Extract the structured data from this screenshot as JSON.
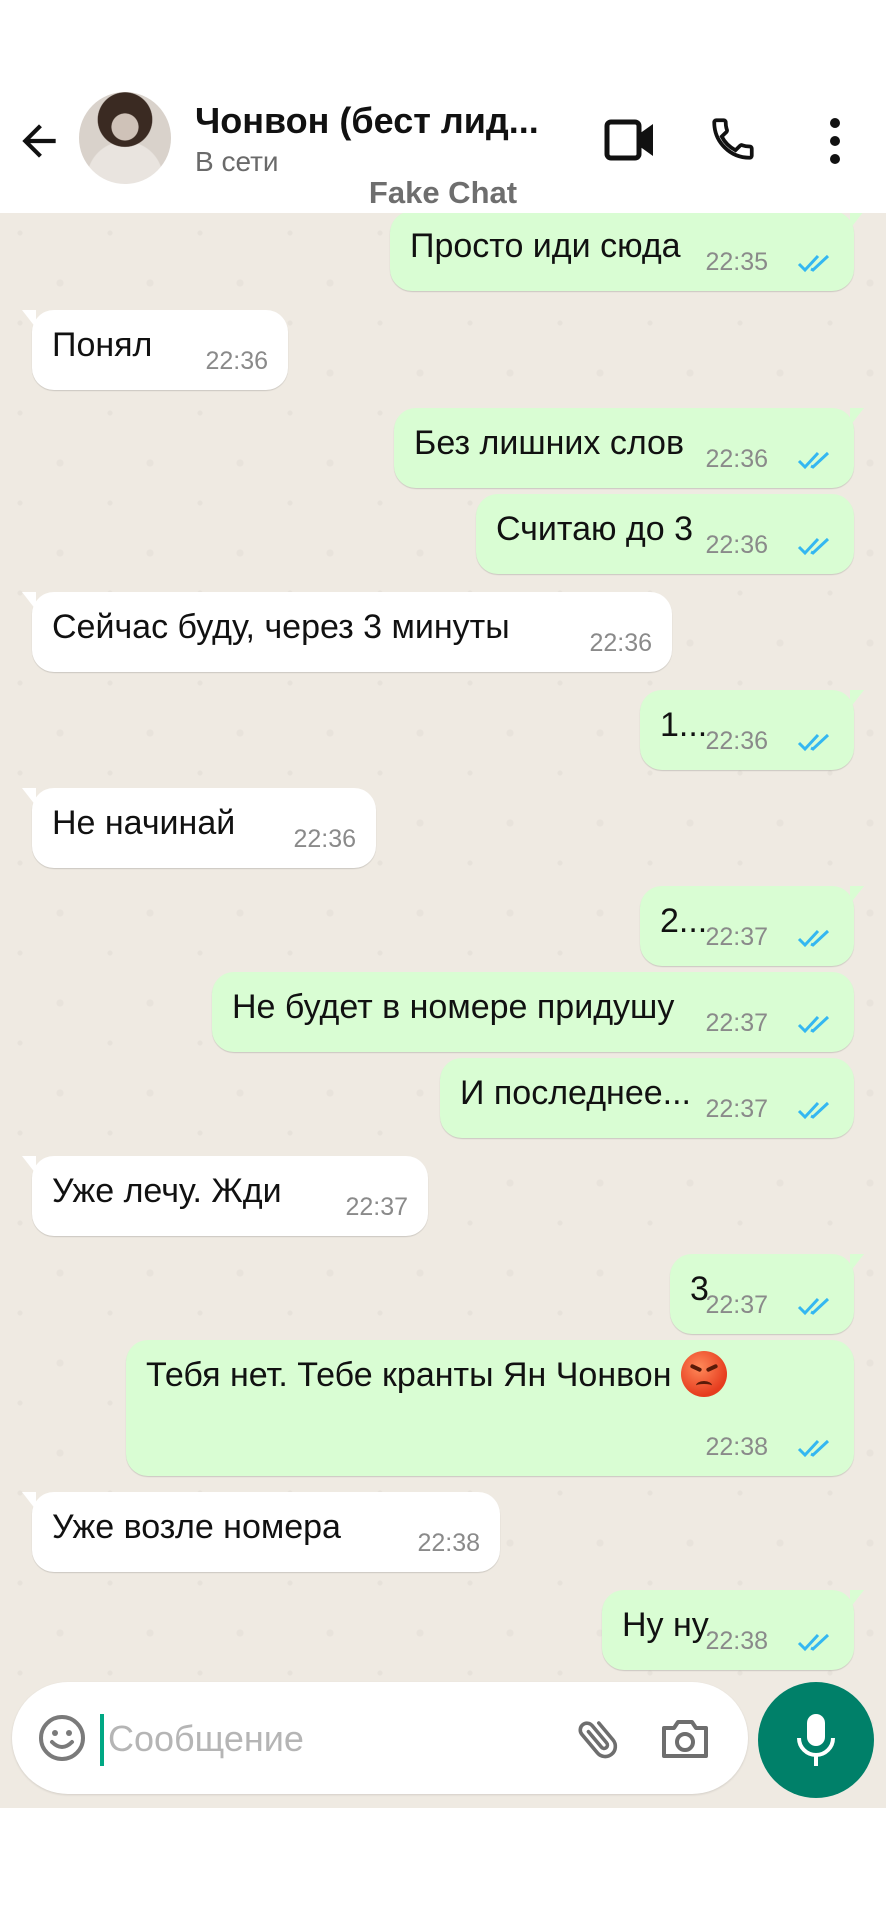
{
  "header": {
    "contact_name": "Чонвон (бест лид...",
    "status": "В сети",
    "watermark": "Fake Chat"
  },
  "colors": {
    "outgoing_bubble": "#d9fdd3",
    "incoming_bubble": "#ffffff",
    "read_ticks": "#34b7f1",
    "accent": "#008069",
    "chat_background": "#efeae2"
  },
  "messages": [
    {
      "dir": "out",
      "text": "Просто иди сюда",
      "time": "22:35",
      "read": true
    },
    {
      "dir": "in",
      "text": "Понял",
      "time": "22:36"
    },
    {
      "dir": "out",
      "text": "Без лишних слов",
      "time": "22:36",
      "read": true
    },
    {
      "dir": "out",
      "text": "Считаю до 3",
      "time": "22:36",
      "read": true
    },
    {
      "dir": "in",
      "text": "Сейчас буду, через 3 минуты",
      "time": "22:36"
    },
    {
      "dir": "out",
      "text": "1...",
      "time": "22:36",
      "read": true
    },
    {
      "dir": "in",
      "text": "Не начинай",
      "time": "22:36"
    },
    {
      "dir": "out",
      "text": "2...",
      "time": "22:37",
      "read": true
    },
    {
      "dir": "out",
      "text": "Не будет в номере придушу",
      "time": "22:37",
      "read": true
    },
    {
      "dir": "out",
      "text": "И последнее...",
      "time": "22:37",
      "read": true
    },
    {
      "dir": "in",
      "text": "Уже лечу. Жди",
      "time": "22:37"
    },
    {
      "dir": "out",
      "text": "3",
      "time": "22:37",
      "read": true
    },
    {
      "dir": "out",
      "text": "Тебя нет. Тебе кранты Ян Чонвон",
      "emoji": "angry-face-icon",
      "time": "22:38",
      "read": true
    },
    {
      "dir": "in",
      "text": "Уже возле номера",
      "time": "22:38"
    },
    {
      "dir": "out",
      "text": "Ну ну",
      "time": "22:38",
      "read": true
    }
  ],
  "composer": {
    "placeholder": "Сообщение"
  },
  "icons": {
    "back": "arrow-left-icon",
    "video": "video-camera-icon",
    "call": "phone-icon",
    "menu": "more-vertical-icon",
    "emoji": "smiley-icon",
    "attach": "paperclip-icon",
    "camera": "camera-icon",
    "mic": "microphone-icon"
  }
}
